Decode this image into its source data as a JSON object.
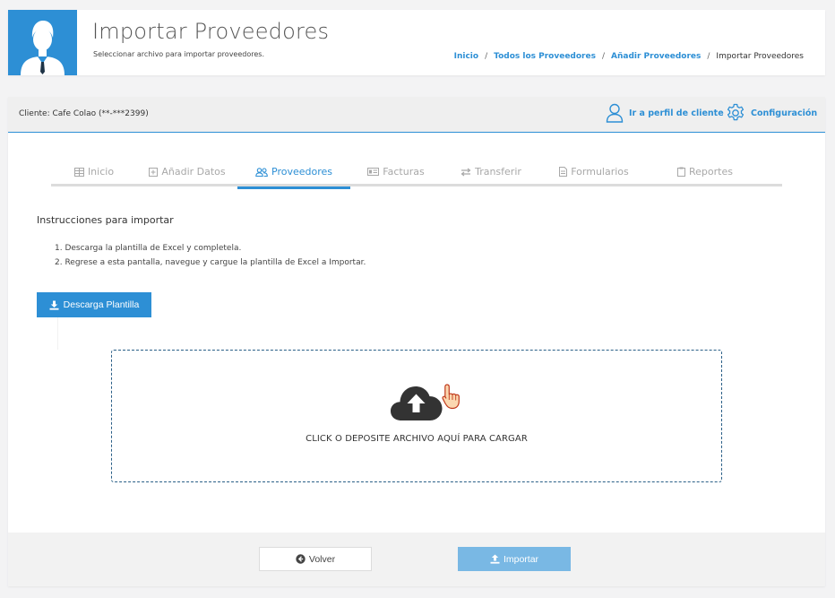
{
  "header": {
    "title": "Importar Proveedores",
    "subtitle": "Seleccionar archivo para importar proveedores.",
    "avatar_icon": "user-avatar-icon",
    "accent_color": "#2d8fd5"
  },
  "breadcrumb": {
    "items": [
      "Inicio",
      "Todos los Proveedores",
      "Añadir Proveedores"
    ],
    "separator": "/",
    "current": "Importar Proveedores"
  },
  "client_bar": {
    "client_label": "Cliente: Cafe Colao (**-***2399)",
    "profile_link": "Ir a perfil de cliente",
    "profile_icon": "user-outline-icon",
    "config_link": "Configuración",
    "config_icon": "gear-icon"
  },
  "tabs": [
    {
      "label": "Inicio",
      "icon": "table-icon",
      "active": false
    },
    {
      "label": "Añadir Datos",
      "icon": "plus-square-icon",
      "active": false
    },
    {
      "label": "Proveedores",
      "icon": "users-icon",
      "active": true
    },
    {
      "label": "Facturas",
      "icon": "id-card-icon",
      "active": false
    },
    {
      "label": "Transferir",
      "icon": "exchange-icon",
      "active": false
    },
    {
      "label": "Formularios",
      "icon": "file-icon",
      "active": false
    },
    {
      "label": "Reportes",
      "icon": "clipboard-icon",
      "active": false
    }
  ],
  "instructions": {
    "title": "Instrucciones para importar",
    "steps": [
      "1. Descarga la plantilla de Excel y completela.",
      "2. Regrese a esta pantalla, navegue y cargue la plantilla de Excel a Importar."
    ]
  },
  "download_button": {
    "label": "Descarga Plantilla",
    "icon": "download-icon"
  },
  "dropzone": {
    "text": "CLICK O DEPOSITE ARCHIVO AQUÍ PARA CARGAR",
    "icon": "cloud-upload-icon",
    "cursor_icon": "hand-pointer-icon"
  },
  "footer": {
    "back_label": "Volver",
    "back_icon": "arrow-circle-left-icon",
    "import_label": "Importar",
    "import_icon": "upload-icon",
    "import_color": "#79b8e4"
  }
}
